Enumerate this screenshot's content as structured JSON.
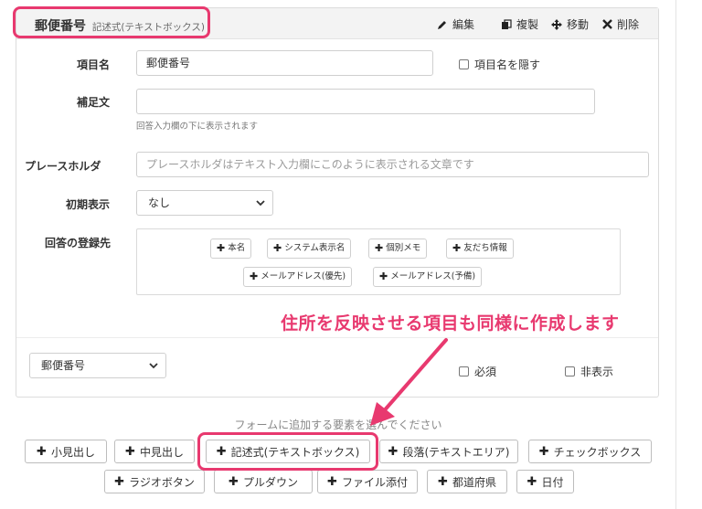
{
  "field": {
    "title": "郵便番号",
    "type_label": "記述式(テキストボックス)",
    "actions": {
      "edit": "編集",
      "duplicate": "複製",
      "move": "移動",
      "delete": "削除"
    },
    "item_name": {
      "label": "項目名",
      "value": "郵便番号",
      "hide_label": "項目名を隠す",
      "hide_checked": false
    },
    "supplement": {
      "label": "補足文",
      "value": "",
      "help": "回答入力欄の下に表示されます"
    },
    "placeholder_row": {
      "label": "プレースホルダ",
      "placeholder": "プレースホルダはテキスト入力欄にこのように表示される文章です"
    },
    "initial_display": {
      "label": "初期表示",
      "selected": "なし"
    },
    "destination": {
      "label": "回答の登録先",
      "chips": [
        "本名",
        "システム表示名",
        "個別メモ",
        "友だち情報",
        "メールアドレス(優先)",
        "メールアドレス(予備)"
      ]
    },
    "footer": {
      "select_value": "郵便番号",
      "required_label": "必須",
      "required_checked": false,
      "hidden_label": "非表示",
      "hidden_checked": false
    }
  },
  "add_elements": {
    "prompt": "フォームに追加する要素を選んでください",
    "buttons": [
      "小見出し",
      "中見出し",
      "記述式(テキストボックス)",
      "段落(テキストエリア)",
      "チェックボックス",
      "ラジオボタン",
      "プルダウン",
      "ファイル添付",
      "都道府県",
      "日付"
    ]
  },
  "annotation": {
    "text": "住所を反映させる項目も同様に作成します",
    "color": "#e8396f"
  }
}
